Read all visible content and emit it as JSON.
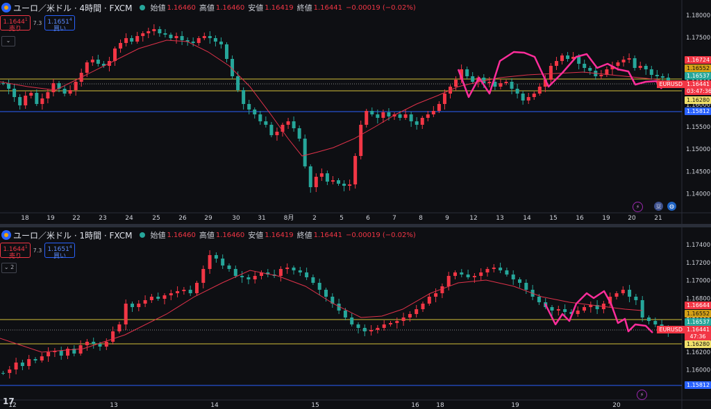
{
  "top": {
    "title": "ユーロ／米ドル · 4時間 · FXCM",
    "open_label": "始値",
    "open": "1.16460",
    "high_label": "高値",
    "high": "1.16460",
    "low_label": "安値",
    "low": "1.16419",
    "close_label": "終値",
    "close": "1.16441",
    "change": "−0.00019 (−0.02%)",
    "sell_price": "1.1644",
    "sell_sup": "1",
    "sell_label": "売り",
    "spread": "7.3",
    "buy_price": "1.1651",
    "buy_sup": "4",
    "buy_label": "買い",
    "collapse": "⌄",
    "axis": [
      "1.18000",
      "1.17500",
      "1.17000",
      "1.16500",
      "1.16000",
      "1.15500",
      "1.15000",
      "1.14500",
      "1.14000"
    ],
    "dates": [
      "18",
      "19",
      "22",
      "23",
      "24",
      "25",
      "26",
      "29",
      "30",
      "31",
      "8月",
      "2",
      "5",
      "6",
      "7",
      "8",
      "9",
      "12",
      "13",
      "14",
      "15",
      "16",
      "19",
      "20",
      "21"
    ],
    "tags": {
      "t1": "1.16724",
      "t2": "1.16552",
      "t3": "1.16537",
      "sym": "EURUSD",
      "price": "1.16441",
      "timer": "03:47:36",
      "t4": "1.16280",
      "t5": "1.15812"
    }
  },
  "bottom": {
    "title": "ユーロ／米ドル · 1時間 · FXCM",
    "open_label": "始値",
    "open": "1.16460",
    "high_label": "高値",
    "high": "1.16460",
    "low_label": "安値",
    "low": "1.16419",
    "close_label": "終値",
    "close": "1.16441",
    "change": "−0.00019 (−0.02%)",
    "sell_price": "1.1644",
    "sell_sup": "1",
    "sell_label": "売り",
    "spread": "7.3",
    "buy_price": "1.1651",
    "buy_sup": "4",
    "buy_label": "買い",
    "collapse": "⌄ 2",
    "axis": [
      "1.17400",
      "1.17200",
      "1.17000",
      "1.16800",
      "1.16600",
      "1.16400",
      "1.16200",
      "1.16000"
    ],
    "dates": [
      "12",
      "13",
      "14",
      "15",
      "16",
      "18",
      "19",
      "20"
    ],
    "tags": {
      "t1": "1.16644",
      "t2": "1.16552",
      "t3": "1.16537",
      "sym": "EURUSD",
      "price": "1.16441",
      "timer": "47:36",
      "t4": "1.16280",
      "t5": "1.15812"
    },
    "logo": "17"
  },
  "colors": {
    "up": "#26a69a",
    "down": "#f23645",
    "ma": "#e0324a",
    "draw": "#ff2d9b",
    "yellow": "#d4c03a",
    "blue": "#2962ff"
  },
  "icons": [
    "tradingview-logo-icon",
    "lightning-icon",
    "us-flag-icon",
    "globe-icon"
  ]
}
